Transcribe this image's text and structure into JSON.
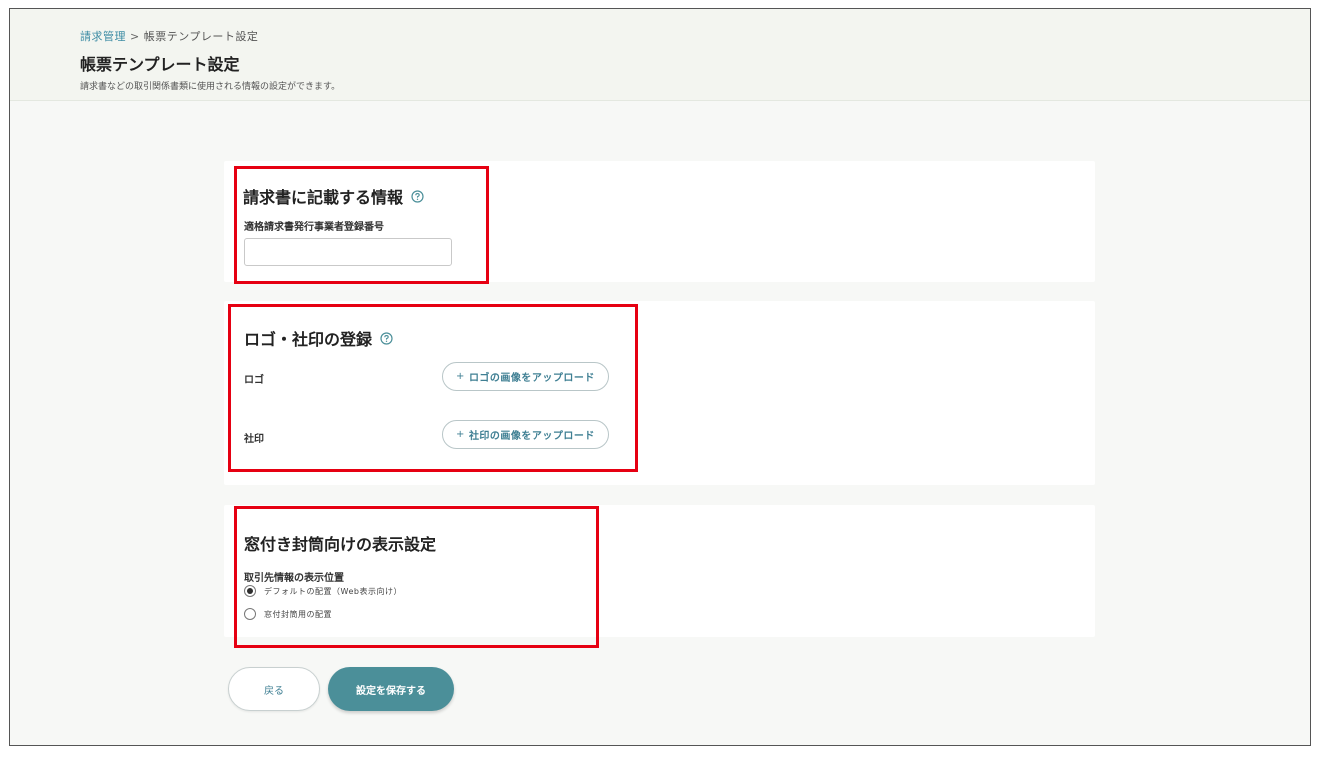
{
  "breadcrumb": {
    "parent": "請求管理",
    "separator": ">",
    "current": "帳票テンプレート設定"
  },
  "page": {
    "title": "帳票テンプレート設定",
    "description": "請求書などの取引関係書類に使用される情報の設定ができます。"
  },
  "invoice_info": {
    "title": "請求書に記載する情報",
    "registration_label": "適格請求書発行事業者登録番号",
    "registration_value": ""
  },
  "logo_seal": {
    "title": "ロゴ・社印の登録",
    "logo_label": "ロゴ",
    "logo_button": "ロゴの画像をアップロード",
    "seal_label": "社印",
    "seal_button": "社印の画像をアップロード"
  },
  "envelope": {
    "title": "窓付き封筒向けの表示設定",
    "position_label": "取引先情報の表示位置",
    "options": [
      {
        "label": "デフォルトの配置（Web表示向け）",
        "checked": true
      },
      {
        "label": "窓付封筒用の配置",
        "checked": false
      }
    ]
  },
  "actions": {
    "back": "戻る",
    "save": "設定を保存する"
  },
  "colors": {
    "accent": "#4b8f99",
    "link": "#3d8ca4",
    "highlight": "#e60012",
    "header_bg": "#f3f5f0"
  },
  "icons": {
    "help": "help-circle-icon",
    "plus": "plus-icon"
  }
}
